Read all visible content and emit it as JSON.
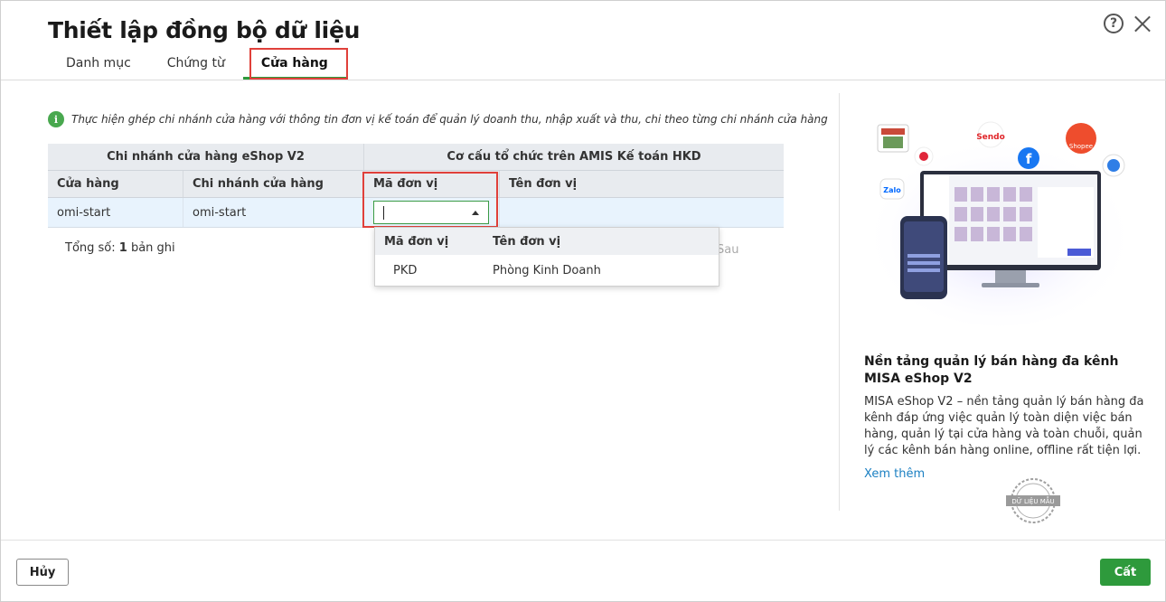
{
  "dialog": {
    "title": "Thiết lập đồng bộ dữ liệu",
    "help_icon": "question-circle-icon",
    "close_icon": "close-icon"
  },
  "tabs": [
    {
      "label": "Danh mục",
      "active": false
    },
    {
      "label": "Chứng từ",
      "active": false
    },
    {
      "label": "Cửa hàng",
      "active": true
    }
  ],
  "info": {
    "icon": "info-icon",
    "text": "Thực hiện ghép chi nhánh cửa hàng với thông tin đơn vị kế toán để quản lý doanh thu, nhập xuất và thu, chi theo từng chi nhánh cửa hàng"
  },
  "grid": {
    "group_headers": [
      "Chi nhánh cửa hàng eShop V2",
      "Cơ cấu tổ chức trên AMIS Kế toán HKD"
    ],
    "columns": [
      "Cửa hàng",
      "Chi nhánh cửa hàng",
      "Mã đơn vị",
      "Tên đơn vị"
    ],
    "rows": [
      {
        "store": "omi-start",
        "branch": "omi-start",
        "unit_code": "",
        "unit_name": ""
      }
    ]
  },
  "total": {
    "prefix": "Tổng số: ",
    "count": "1",
    "suffix": " bản ghi"
  },
  "pager": {
    "next": "Sau"
  },
  "dropdown": {
    "headers": [
      "Mã đơn vị",
      "Tên đơn vị"
    ],
    "options": [
      {
        "code": "PKD",
        "name": "Phòng Kinh Doanh"
      }
    ]
  },
  "side": {
    "title": "Nền tảng quản lý bán hàng đa kênh MISA eShop V2",
    "description": "MISA eShop V2 – nền tảng quản lý bán hàng đa kênh đáp ứng việc quản lý toàn diện việc bán hàng, quản lý tại cửa hàng và toàn chuỗi, quản lý các kênh bán hàng online, offline rất tiện lợi.",
    "link": "Xem thêm",
    "stamp_text": "DỮ LIỆU MẪU"
  },
  "illustration_labels": {
    "sendo": "Sendo",
    "shopee": "Shopee",
    "zalo": "Zalo",
    "facebook": "f"
  },
  "footer": {
    "cancel": "Hủy",
    "save": "Cất"
  },
  "colors": {
    "accent": "#2e9a3c",
    "highlight": "#e0403a",
    "link": "#1a7fc2"
  }
}
